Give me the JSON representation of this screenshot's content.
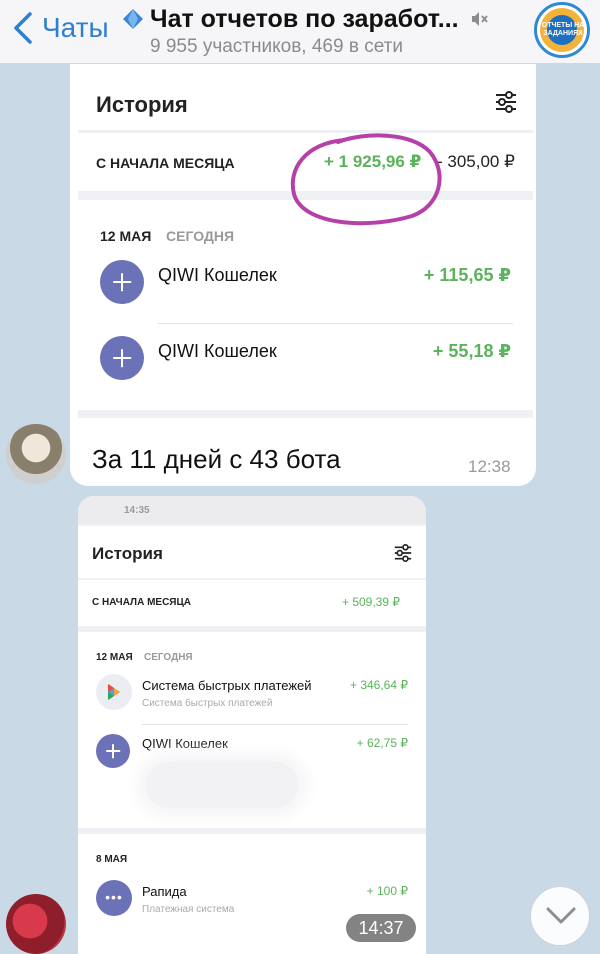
{
  "header": {
    "back_label": "Чаты",
    "title": "Чат отчетов по заработ...",
    "subtitle": "9 955 участников, 469 в сети",
    "channel_logo_text": "ОТЧЕТЫ НА ЗАДАНИЯХ"
  },
  "message1": {
    "screenshot": {
      "title": "История",
      "month_label": "С НАЧАЛА МЕСЯЦА",
      "month_income": "+ 1 925,96 ₽",
      "month_expense": "- 305,00 ₽",
      "date_label": "12 МАЯ",
      "date_sub": "СЕГОДНЯ",
      "transactions": [
        {
          "name": "QIWI Кошелек",
          "amount": "+ 115,65 ₽"
        },
        {
          "name": "QIWI Кошелек",
          "amount": "+ 55,18 ₽"
        }
      ]
    },
    "text": "За 11 дней с 43 бота",
    "time": "12:38"
  },
  "message2": {
    "screenshot": {
      "status_time": "14:35",
      "title": "История",
      "month_label": "С НАЧАЛА МЕСЯЦА",
      "month_income": "+ 509,39 ₽",
      "date_label": "12 МАЯ",
      "date_sub": "СЕГОДНЯ",
      "transactions": [
        {
          "name": "Система быстрых платежей",
          "sub": "Система быстрых платежей",
          "amount": "+ 346,64 ₽"
        },
        {
          "name": "QIWI Кошелек",
          "sub": "",
          "amount": "+ 62,75 ₽"
        }
      ],
      "date2_label": "8 МАЯ",
      "transaction3": {
        "name": "Рапида",
        "sub": "Платежная система",
        "amount": "+ 100 ₽"
      }
    },
    "time": "14:37"
  },
  "colors": {
    "accent": "#2f7fd1",
    "income": "#5bb35b",
    "circle_icon": "#6b72b8",
    "scribble": "#b640a8"
  }
}
